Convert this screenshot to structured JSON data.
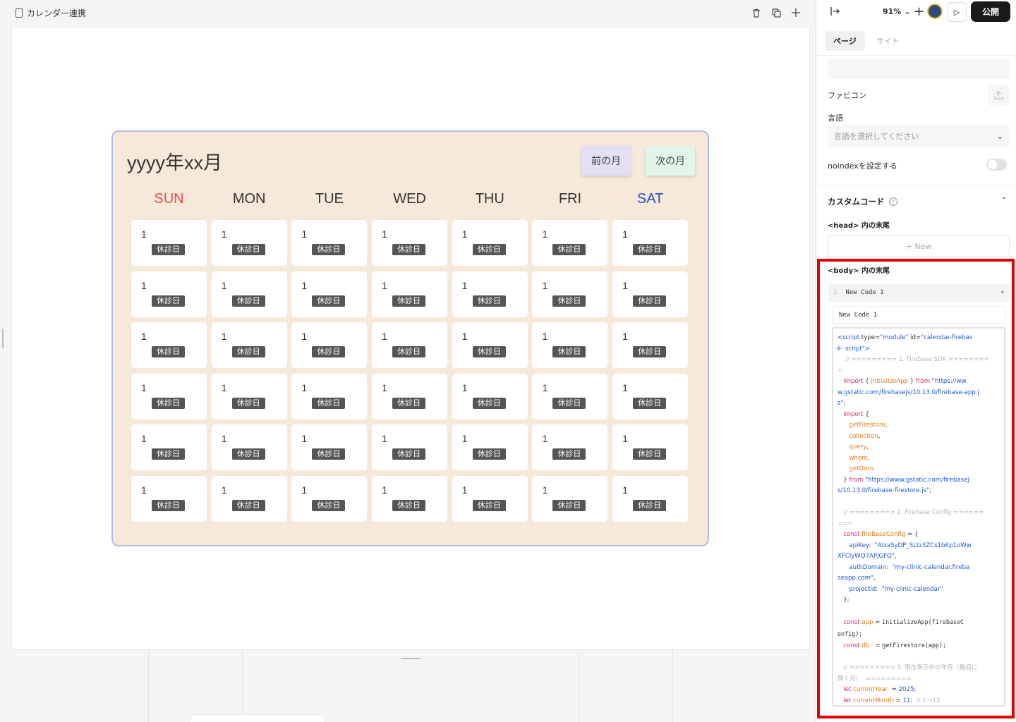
{
  "page": {
    "title": "カレンダー連携"
  },
  "calendar": {
    "title": "yyyy年xx月",
    "prev_label": "前の月",
    "next_label": "次の月",
    "weekdays": [
      {
        "label": "SUN",
        "color": "#e84c4c"
      },
      {
        "label": "MON",
        "color": "#333333"
      },
      {
        "label": "TUE",
        "color": "#333333"
      },
      {
        "label": "WED",
        "color": "#333333"
      },
      {
        "label": "THU",
        "color": "#333333"
      },
      {
        "label": "FRI",
        "color": "#333333"
      },
      {
        "label": "SAT",
        "color": "#2b4fc4"
      }
    ],
    "rows": 6,
    "cell": {
      "day": "1",
      "badge": "休診日"
    },
    "bg_color": "#f7e9d9"
  },
  "panel": {
    "zoom": "91%",
    "publish_label": "公開",
    "tabs": [
      {
        "label": "ページ"
      },
      {
        "label": "サイト"
      }
    ],
    "favicon_label": "ファビコン",
    "language_label": "言語",
    "language_placeholder": "言語を選択してください",
    "noindex_label": "noindexを設定する",
    "custom_code_title": "カスタムコード",
    "head_title": "<head> 内の末尾",
    "new_label": "+ New",
    "body_title": "<body> 内の末尾",
    "code_item": {
      "line": "1",
      "name": "New Code 1"
    },
    "code_name_value": "New Code 1"
  },
  "colors": {
    "accent_red": "#e60000",
    "publish_bg": "#1a1a1a"
  }
}
